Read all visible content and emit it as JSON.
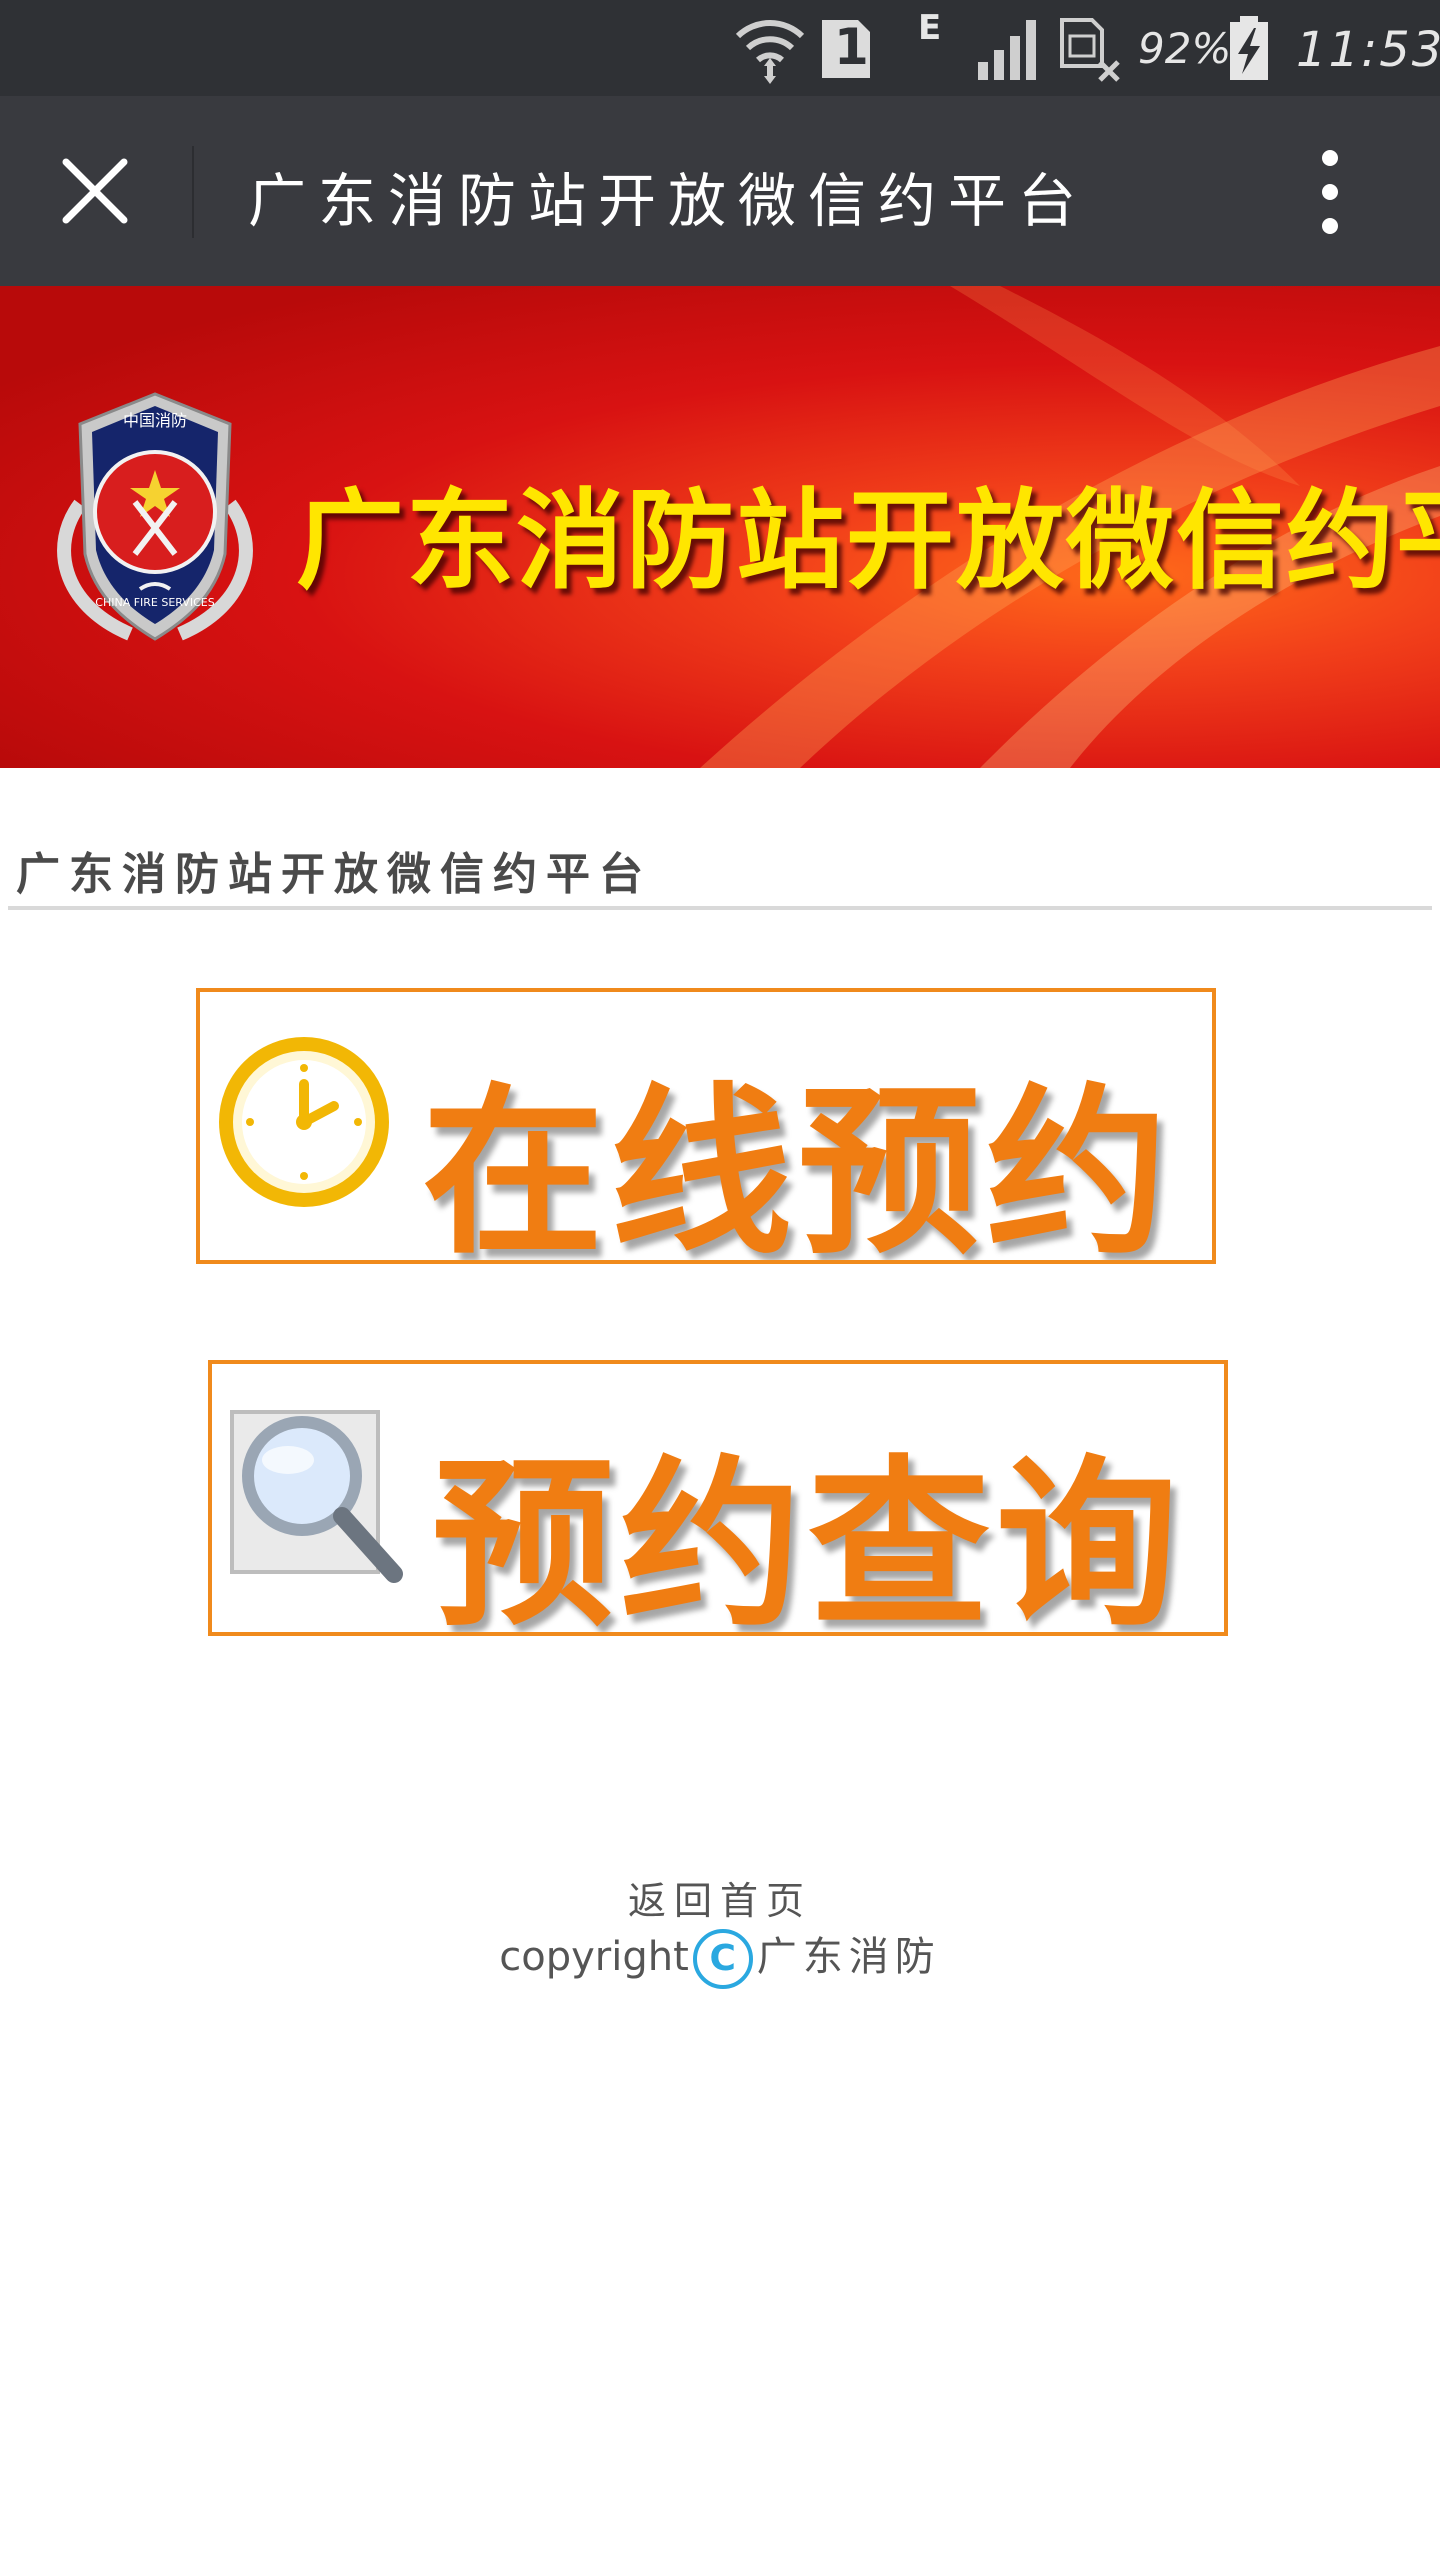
{
  "status_bar": {
    "network_type": "E",
    "sim_slot": "1",
    "battery_percent": "92%",
    "time": "11:53"
  },
  "app_bar": {
    "title": "广东消防站开放微信约平台"
  },
  "banner": {
    "title": "广东消防站开放微信约平台",
    "emblem": {
      "top_text": "中国消防",
      "ring_text": "CHINA FIRE SERVICES"
    }
  },
  "section": {
    "heading": "广东消防站开放微信约平台"
  },
  "actions": {
    "online_booking": {
      "label": "在线预约",
      "icon": "clock-icon"
    },
    "booking_query": {
      "label": "预约查询",
      "icon": "magnifier-icon"
    }
  },
  "footer": {
    "home_link": "返回首页",
    "copyright_prefix": "copyright",
    "copyright_symbol": "C",
    "copyright_org": "广东消防"
  },
  "colors": {
    "status_bar_bg": "#2f3135",
    "app_bar_bg": "#393a3f",
    "banner_red": "#d81212",
    "banner_title": "#ffe600",
    "accent_orange": "#f07d12",
    "copyright_blue": "#2aa8e0"
  }
}
